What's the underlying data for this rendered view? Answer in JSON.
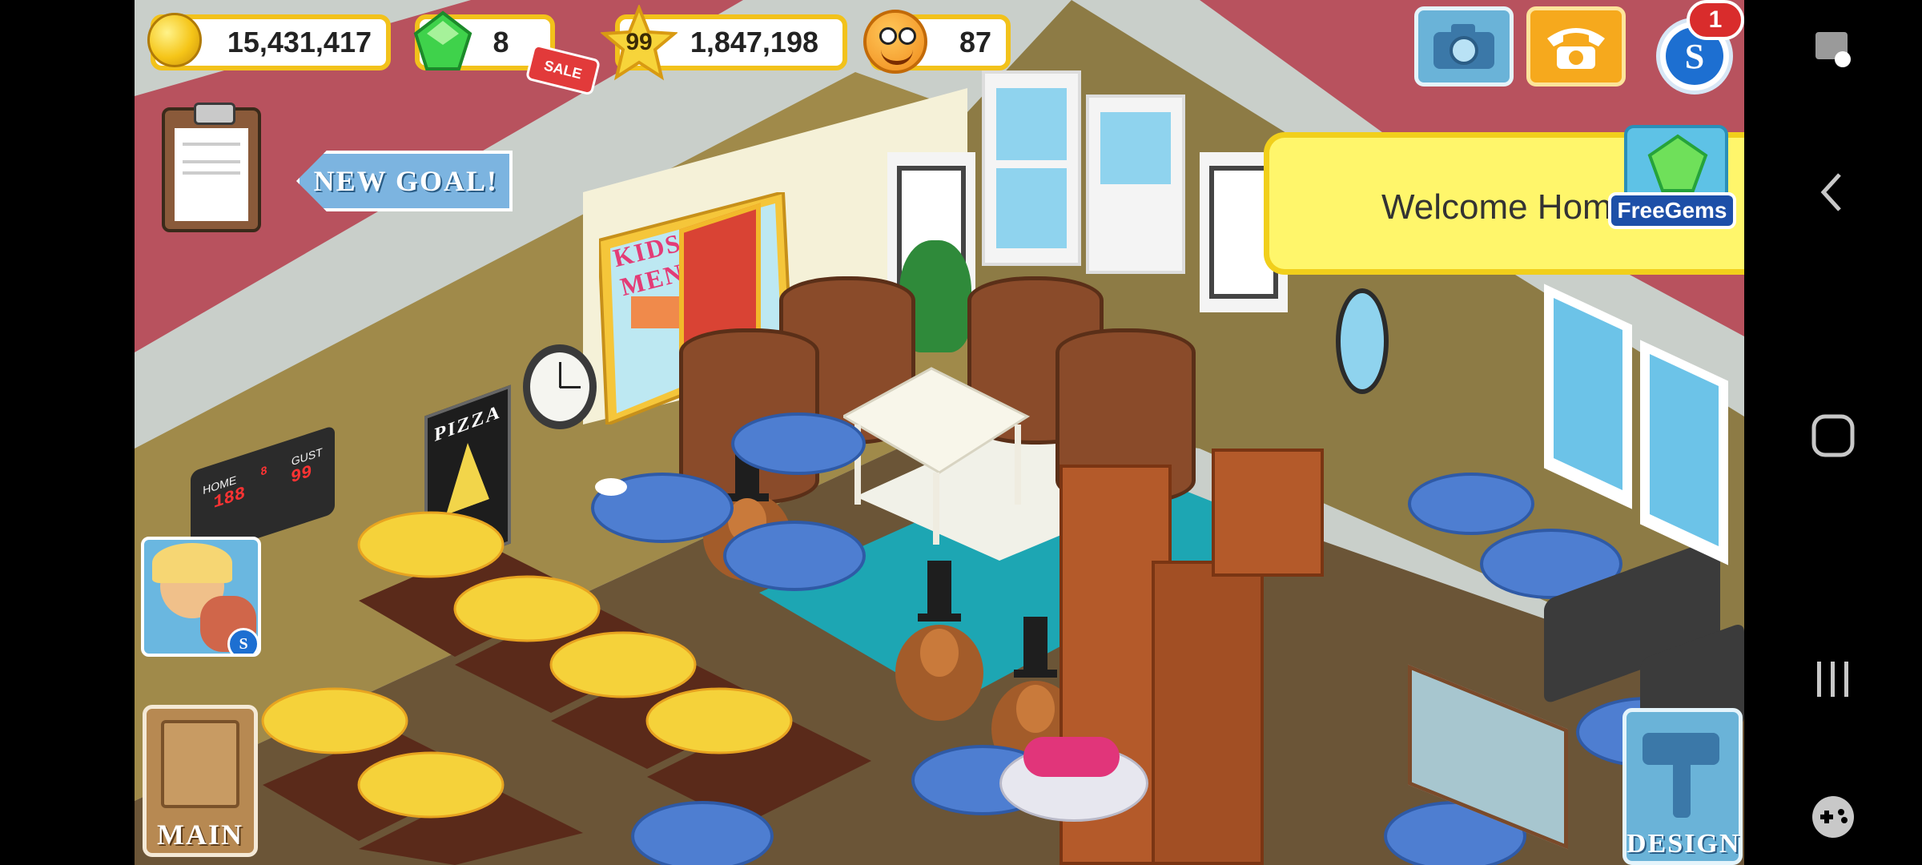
{
  "hud": {
    "coins": "15,431,417",
    "gems": "8",
    "gems_badge": "SALE",
    "level": "99",
    "experience": "1,847,198",
    "happiness": "87"
  },
  "goal_banner": {
    "label": "NEW GOAL!"
  },
  "top_right": {
    "notification_count": "1"
  },
  "welcome_popup": {
    "message": "Welcome Hom",
    "free_gems_label": "FreeGems"
  },
  "kids_menu": {
    "title": "KIDS MENU"
  },
  "pizza_sign": {
    "title": "PIZZA"
  },
  "scoreboard": {
    "label_home": "HOME",
    "label_guest": "GUST",
    "home_score": "188",
    "guest_score": "99",
    "period": "8"
  },
  "bottom_left": {
    "main_label": "MAIN"
  },
  "bottom_right": {
    "design_label": "DESIGN"
  },
  "colors": {
    "gold": "#f2c21b",
    "panel_yellow": "#fff66b",
    "accent_blue": "#1d6fd1"
  }
}
